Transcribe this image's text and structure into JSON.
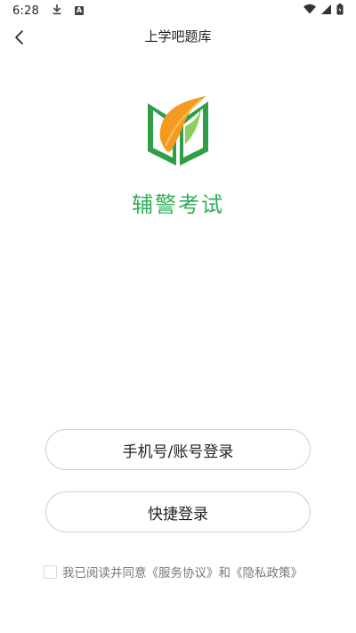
{
  "status_bar": {
    "time": "6:28",
    "download_icon": "download-icon",
    "a_badge": "A",
    "wifi_icon": "wifi-icon",
    "signal_icon": "signal-icon",
    "battery_icon": "battery-icon"
  },
  "nav": {
    "title": "上学吧题库",
    "back_icon": "chevron-left-icon"
  },
  "app": {
    "name": "辅警考试",
    "logo_icon": "book-leaf-logo",
    "brand_color": "#2fae58",
    "accent_color": "#f39a1f"
  },
  "buttons": {
    "phone_login": "手机号/账号登录",
    "quick_login": "快捷登录"
  },
  "agreement": {
    "prefix": "我已阅读并同意",
    "service": "《服务协议》",
    "and": "和",
    "privacy": "《隐私政策》",
    "checked": false
  }
}
